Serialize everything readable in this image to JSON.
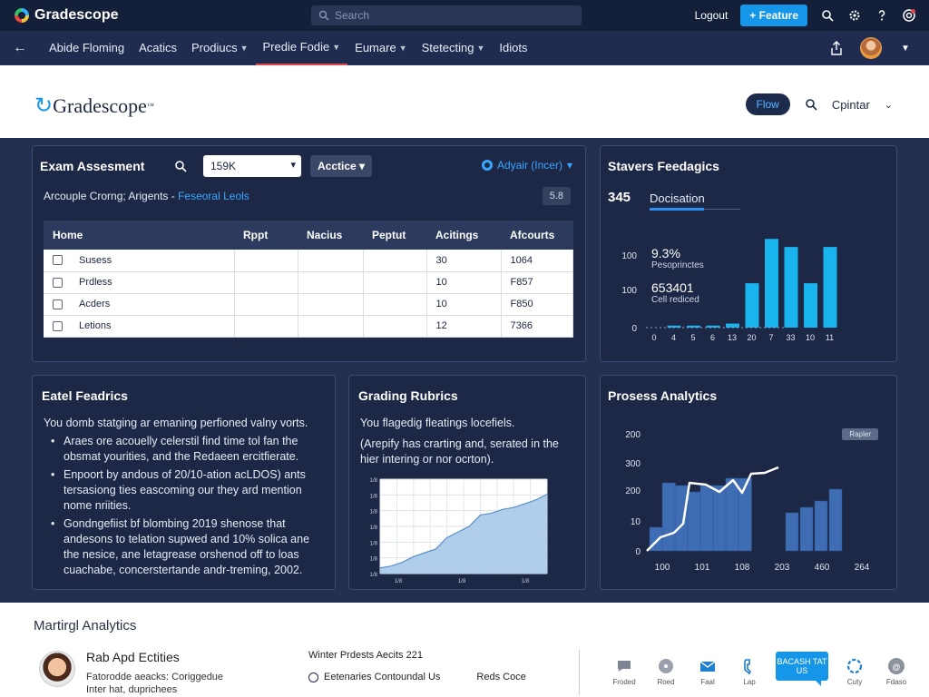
{
  "app": {
    "name": "Gradescope",
    "search_placeholder": "Search",
    "login": "Logout",
    "primary_button": "+ Feature"
  },
  "nav": {
    "items": [
      {
        "label": "Abide Floming",
        "has_menu": false,
        "active": false
      },
      {
        "label": "Acatics",
        "has_menu": false,
        "active": false
      },
      {
        "label": "Prodiucs",
        "has_menu": true,
        "active": false
      },
      {
        "label": "Predie Fodie",
        "has_menu": true,
        "active": true
      },
      {
        "label": "Eumare",
        "has_menu": true,
        "active": false
      },
      {
        "label": "Stetecting",
        "has_menu": true,
        "active": false
      },
      {
        "label": "Idiots",
        "has_menu": false,
        "active": false
      }
    ]
  },
  "header": {
    "logo_text": "Gradescope",
    "pill": "Flow",
    "right_label": "Cpintar"
  },
  "exam": {
    "title": "Exam Assesment",
    "select_value": "159K",
    "action": "Acctice",
    "assign": "Adyair (Incer)",
    "subtitle": "Arcouple Crorng; Arigents -",
    "subtitle_link": "Feseoral Leols",
    "count": "5.8",
    "columns": [
      "Home",
      "Rppt",
      "Nacius",
      "Peptut",
      "Acitings",
      "Afcourts"
    ],
    "rows": [
      {
        "name": "Susess",
        "c4": "30",
        "c5": "1064"
      },
      {
        "name": "Prdless",
        "c4": "10",
        "c5": "F857"
      },
      {
        "name": "Acders",
        "c4": "10",
        "c5": "F850"
      },
      {
        "name": "Letions",
        "c4": "12",
        "c5": "7366"
      }
    ]
  },
  "feedback": {
    "title": "Stavers Feedagics",
    "big_number": "345",
    "tab": "Docisation",
    "stat1_value": "9.3%",
    "stat1_label": "Pesoprinctes",
    "stat2_value": "653401",
    "stat2_label": "Cell rediced"
  },
  "eatel": {
    "title": "Eatel Feadrics",
    "intro": "You domb statging ar emaning perfioned valny vorts.",
    "bullets": [
      "Araes ore acouelly celerstil find time tol fan the obsmat yourities, and the Redaeen ercitfierate.",
      "Enpoort by andous of 20/10-ation acLDOS) ants tersasiong ties eascoming our they ard mention nome nriities.",
      "Gondngefiist bf blombing 2019 shenose that andesons to telation supwed and 10% solica ane the nesice, ane letagrease orshenod off to loas cuachabe, concerstertande andr-treming, 2002."
    ]
  },
  "rubrics": {
    "title": "Grading Rubrics",
    "line1": "You flagedig fleatings locefiels.",
    "line2": "(Arepify has crarting and, serated in the hier intering or nor ocrton)."
  },
  "process": {
    "title": "Prosess Analytics",
    "button": "Rapler"
  },
  "footer": {
    "title": "Martirgl Analytics",
    "name": "Rab Apd Ectities",
    "desc": "Fatorodde aeacks: Coriggedue Inter hat, duprichees",
    "mid_top": "Winter Prdests Aecits 221",
    "mid_left": "Eetenaries Contoundal Us",
    "mid_right": "Reds Coce",
    "icons": [
      {
        "name": "chat-icon",
        "label": "Froded"
      },
      {
        "name": "disc-icon",
        "label": "Roed"
      },
      {
        "name": "mail-icon",
        "label": "Faal"
      },
      {
        "name": "phone-icon",
        "label": "Lap"
      }
    ],
    "bubble": "BACASH TAT US",
    "icons_right": [
      {
        "name": "refresh-icon",
        "label": "Cuty"
      },
      {
        "name": "users-icon",
        "label": "Fdaso"
      }
    ]
  },
  "chart_data": [
    {
      "type": "bar",
      "title": "",
      "categories": [
        "0",
        "4",
        "5",
        "6",
        "13",
        "20",
        "7",
        "33",
        "10",
        "11"
      ],
      "values": [
        0,
        1,
        1,
        1,
        2,
        22,
        44,
        40,
        22,
        40
      ],
      "yticks": [
        "100",
        "100",
        "0"
      ],
      "color": "#19b4ee"
    },
    {
      "type": "area",
      "title": "",
      "x": [
        0,
        1,
        2,
        3,
        4,
        5,
        6,
        7,
        8,
        9,
        10,
        11,
        12,
        13,
        14,
        15
      ],
      "values": [
        6,
        8,
        12,
        18,
        22,
        26,
        38,
        44,
        50,
        62,
        64,
        68,
        70,
        74,
        78,
        84
      ],
      "yticks": [
        "1/8",
        "1/8",
        "1/8",
        "1/8",
        "1/8",
        "1/8",
        "1/8"
      ],
      "xticks": [
        "1/8",
        "1/8",
        "1/8"
      ],
      "color": "#a7c9ea"
    },
    {
      "type": "bar+line",
      "title": "",
      "categories": [
        "100",
        "101",
        "108",
        "203",
        "460",
        "264"
      ],
      "bars": [
        26,
        75,
        72,
        65,
        72,
        72,
        80,
        80,
        42,
        48,
        55,
        68
      ],
      "line": [
        0,
        15,
        20,
        30,
        75,
        73,
        65,
        78,
        64,
        85,
        86,
        92
      ],
      "yticks": [
        "200",
        "300",
        "200",
        "10",
        "0"
      ],
      "bar_color": "#3f6db3",
      "line_color": "#ffffff"
    }
  ]
}
